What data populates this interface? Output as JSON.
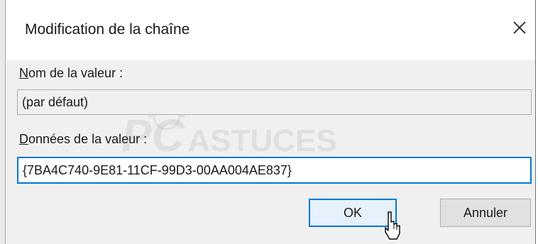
{
  "dialog": {
    "title": "Modification de la chaîne",
    "close_glyph": "✕"
  },
  "name_section": {
    "label_mnemonic": "N",
    "label_rest": "om de la valeur :",
    "value": "(par défaut)"
  },
  "data_section": {
    "label_mnemonic": "D",
    "label_rest": "onnées de la valeur :",
    "value": "{7BA4C740-9E81-11CF-99D3-00AA004AE837}"
  },
  "buttons": {
    "ok": "OK",
    "cancel": "Annuler"
  },
  "watermark": {
    "part1": "PC",
    "part2": "ASTUCES"
  },
  "icons": [
    "close-icon",
    "mouse-cursor-icon",
    "lightbulb-watermark-icon"
  ],
  "colors": {
    "accent": "#0078d7",
    "client_bg": "#f0f0f0",
    "ok_bg": "#e5f1fb"
  }
}
